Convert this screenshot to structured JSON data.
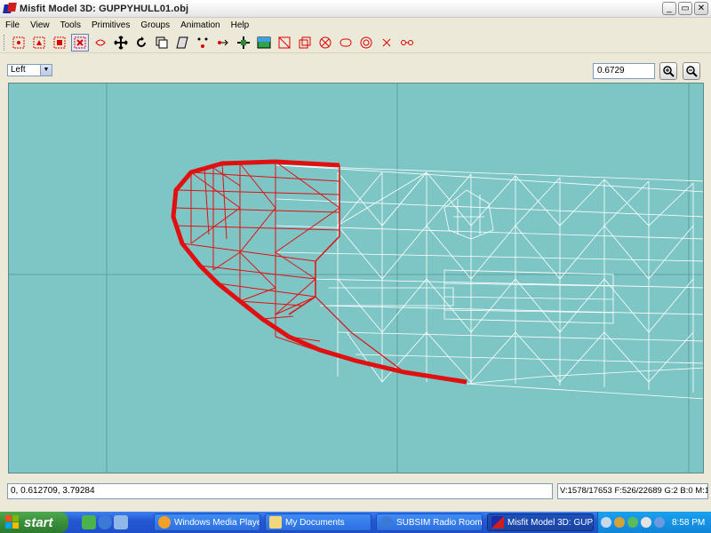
{
  "window": {
    "title": "Misfit Model 3D: GUPPYHULL01.obj",
    "minimize": "_",
    "maximize": "▭",
    "close": "✕"
  },
  "menu": [
    "File",
    "View",
    "Tools",
    "Primitives",
    "Groups",
    "Animation",
    "Help"
  ],
  "toolbar": {
    "tools": [
      "select-vertices-icon",
      "select-faces-icon",
      "select-groups-icon",
      "select-bone-icon",
      "select-point-icon",
      "move-icon",
      "rotate-icon",
      "scale-icon",
      "shear-icon",
      "attach-vertex-icon",
      "attach-point-icon",
      "joint-icon",
      "texture-projection-icon",
      "create-rectangle-icon",
      "create-cube-icon",
      "create-ellipse-icon",
      "create-cylinder-icon",
      "create-torus-icon",
      "create-polygon-icon",
      "create-bone-icon"
    ],
    "active_index": 3
  },
  "view": {
    "selected": "Left",
    "zoom": "0.6729"
  },
  "status": {
    "coords": "0, 0.612709, 3.79284",
    "stats": "V:1578/17653  F:526/22689  G:2  B:0  M:1"
  },
  "taskbar": {
    "start_label": "start",
    "tasks": [
      "Windows Media Player",
      "My Documents",
      "SUBSIM Radio Room ...",
      "Misfit Model 3D: GUP..."
    ],
    "active_task": 3,
    "clock": "8:58 PM"
  },
  "colors": {
    "viewport_bg": "#7ec6c6",
    "selected_mesh": "#e01010",
    "unselected_mesh": "#ffffff"
  }
}
